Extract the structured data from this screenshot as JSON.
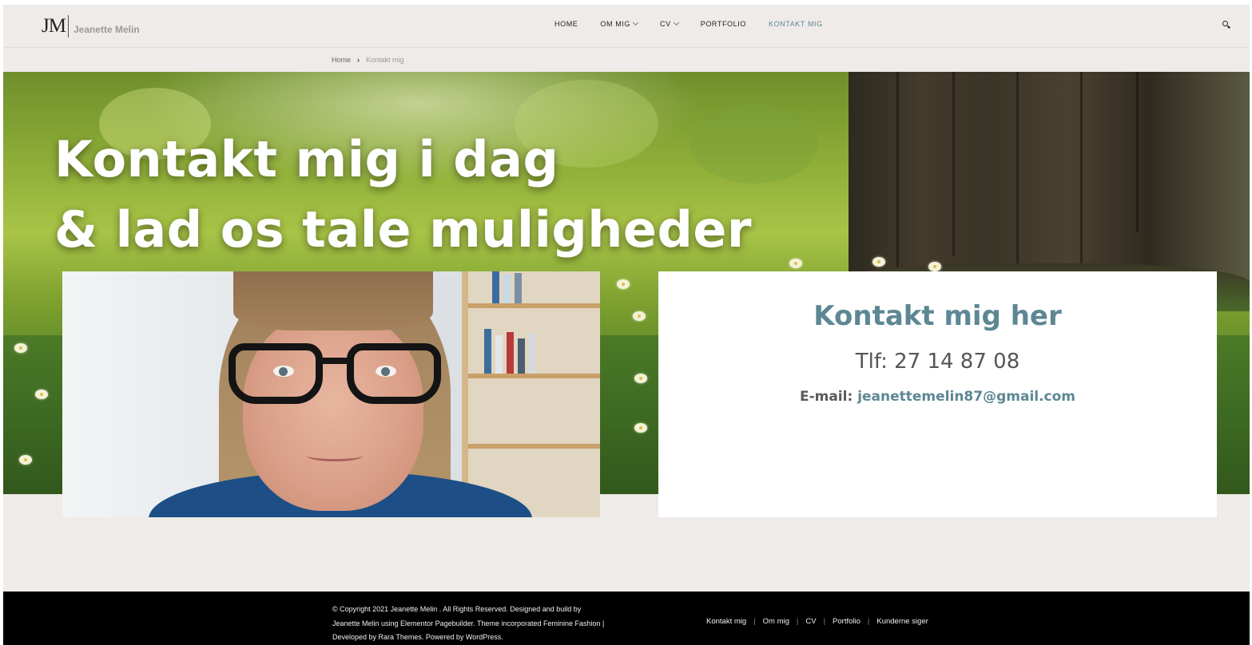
{
  "header": {
    "logo_mark": "JM",
    "logo_name": "Jeanette Melin",
    "nav": [
      {
        "label": "HOME",
        "has_dropdown": false,
        "active": false
      },
      {
        "label": "OM MIG",
        "has_dropdown": true,
        "active": false
      },
      {
        "label": "CV",
        "has_dropdown": true,
        "active": false
      },
      {
        "label": "PORTFOLIO",
        "has_dropdown": false,
        "active": false
      },
      {
        "label": "KONTAKT MIG",
        "has_dropdown": false,
        "active": true
      }
    ],
    "search_icon": "search-icon"
  },
  "breadcrumb": {
    "home": "Home",
    "separator_icon": "chevron-right-icon",
    "current": "Kontakt mig"
  },
  "hero": {
    "headline_line1": "Kontakt mig i dag",
    "headline_line2": "& lad os tale muligheder"
  },
  "contact_card": {
    "title": "Kontakt mig her",
    "phone": "Tlf: 27 14 87 08",
    "email_label": "E-mail:",
    "email": "jeanettemelin87@gmail.com"
  },
  "footer": {
    "copyright_line1": "© Copyright 2021 Jeanette Melin . All Rights Reserved. Designed and build by",
    "copyright_line2": "Jeanette Melin using Elementor Pagebuilder. Theme incorporated Feminine Fashion |",
    "copyright_line3": "Developed by Rara Themes. Powered by WordPress.",
    "links": [
      "Kontakt mig",
      "Om mig",
      "CV",
      "Portfolio",
      "Kunderne siger"
    ]
  },
  "colors": {
    "accent": "#5d8793",
    "page_background": "#efebe8",
    "footer_background": "#000000"
  }
}
